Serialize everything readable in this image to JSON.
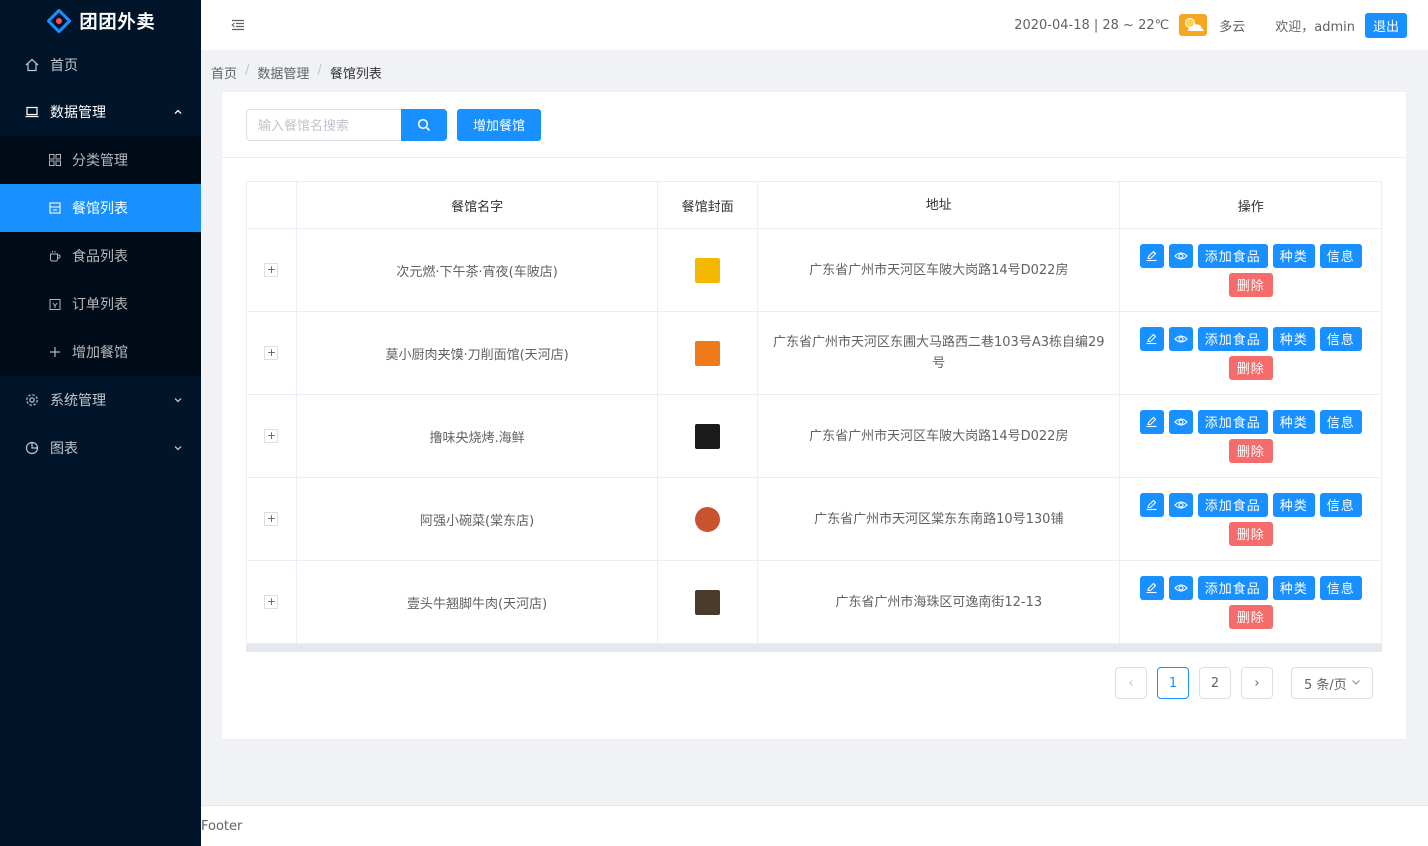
{
  "app": {
    "title": "团团外卖"
  },
  "sidebar": {
    "items": [
      {
        "label": "首页",
        "icon": "home-icon"
      },
      {
        "label": "数据管理",
        "icon": "laptop-icon",
        "open": true,
        "children": [
          {
            "label": "分类管理",
            "icon": "appstore-icon"
          },
          {
            "label": "餐馆列表",
            "icon": "shop-icon",
            "active": true
          },
          {
            "label": "食品列表",
            "icon": "coffee-icon"
          },
          {
            "label": "订单列表",
            "icon": "order-icon"
          },
          {
            "label": "增加餐馆",
            "icon": "plus-icon"
          }
        ]
      },
      {
        "label": "系统管理",
        "icon": "setting-icon"
      },
      {
        "label": "图表",
        "icon": "pie-chart-icon"
      }
    ]
  },
  "header": {
    "weather": "2020-04-18 | 28 ~ 22℃",
    "weather_desc": "多云",
    "welcome": "欢迎，admin",
    "logout": "退出"
  },
  "breadcrumb": [
    "首页",
    "数据管理",
    "餐馆列表"
  ],
  "toolbar": {
    "search_placeholder": "输入餐馆名搜索",
    "add_label": "增加餐馆"
  },
  "table": {
    "columns": [
      "",
      "餐馆名字",
      "餐馆封面",
      "地址",
      "操作"
    ],
    "rows": [
      {
        "name": "次元燃·下午茶·宵夜(车陂店)",
        "address": "广东省广州市天河区车陂大岗路14号D022房",
        "cover_color": "#f5b800"
      },
      {
        "name": "莫小厨肉夹馍·刀削面馆(天河店)",
        "address": "广东省广州市天河区东圃大马路西二巷103号A3栋自编29号",
        "cover_color": "#f07a1a"
      },
      {
        "name": "撸味央烧烤.海鲜",
        "address": "广东省广州市天河区车陂大岗路14号D022房",
        "cover_color": "#1a1a1a"
      },
      {
        "name": "阿强小碗菜(棠东店)",
        "address": "广东省广州市天河区棠东东南路10号130铺",
        "cover_color": "#c9532e"
      },
      {
        "name": "壹头牛翘脚牛肉(天河店)",
        "address": "广东省广州市海珠区可逸南街12-13",
        "cover_color": "#4a3a2a"
      }
    ],
    "actions": {
      "add_food": "添加食品",
      "category": "种类",
      "info": "信息",
      "delete": "删除"
    },
    "expand_symbol": "+"
  },
  "pagination": {
    "prev": "‹",
    "next": "›",
    "pages": [
      "1",
      "2"
    ],
    "current": "1",
    "page_size": "5 条/页"
  },
  "footer": {
    "text": "Footer"
  }
}
